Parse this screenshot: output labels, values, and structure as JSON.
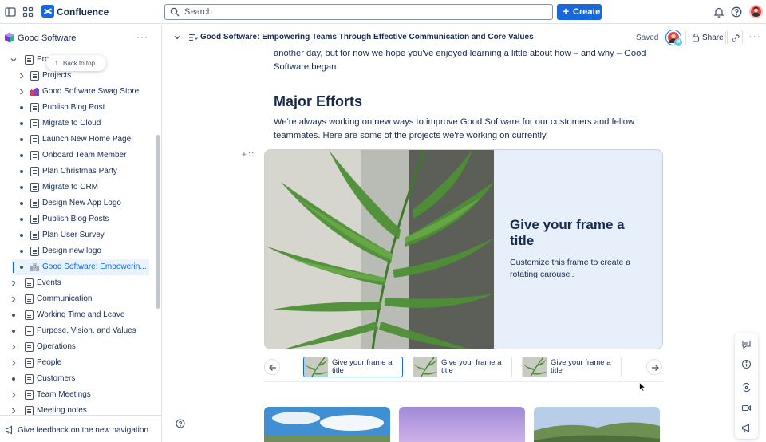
{
  "app": {
    "name": "Confluence",
    "brand_color": "#1868db"
  },
  "topbar": {
    "search_placeholder": "Search",
    "create_label": "Create",
    "icons": [
      "sidebar-toggle-icon",
      "app-switcher-icon",
      "bell-icon",
      "help-icon"
    ]
  },
  "sidebar": {
    "space_name": "Good Software",
    "more_label": "···",
    "back_to_top": "Back to top",
    "items": [
      {
        "label": "Pro",
        "kind": "page",
        "level": 1,
        "expanded": true,
        "chevron": true
      },
      {
        "label": "Projects",
        "kind": "database",
        "level": 2,
        "chevron": true
      },
      {
        "label": "Good Software Swag Store",
        "kind": "emoji",
        "level": 2,
        "chevron": true
      },
      {
        "label": "Publish Blog Post",
        "kind": "page",
        "level": 2
      },
      {
        "label": "Migrate to Cloud",
        "kind": "page",
        "level": 2
      },
      {
        "label": "Launch New Home Page",
        "kind": "page",
        "level": 2
      },
      {
        "label": "Onboard Team Member",
        "kind": "page",
        "level": 2
      },
      {
        "label": "Plan Christmas Party",
        "kind": "page",
        "level": 2
      },
      {
        "label": "Migrate to CRM",
        "kind": "page",
        "level": 2
      },
      {
        "label": "Design New App Logo",
        "kind": "page",
        "level": 2
      },
      {
        "label": "Publish Blog Posts",
        "kind": "page",
        "level": 2
      },
      {
        "label": "Plan User Survey",
        "kind": "page",
        "level": 2
      },
      {
        "label": "Design new logo",
        "kind": "page",
        "level": 2
      },
      {
        "label": "Good Software: Empowerin...",
        "kind": "emoji",
        "level": 2,
        "active": true
      },
      {
        "label": "Events",
        "kind": "page",
        "level": 1,
        "chevron": true
      },
      {
        "label": "Communication",
        "kind": "page",
        "level": 1,
        "chevron": true
      },
      {
        "label": "Working Time and Leave",
        "kind": "page",
        "level": 1
      },
      {
        "label": "Purpose, Vision, and Values",
        "kind": "page",
        "level": 1
      },
      {
        "label": "Operations",
        "kind": "page",
        "level": 1,
        "chevron": true
      },
      {
        "label": "People",
        "kind": "page",
        "level": 1,
        "chevron": true
      },
      {
        "label": "Customers",
        "kind": "page",
        "level": 1
      },
      {
        "label": "Team Meetings",
        "kind": "page",
        "level": 1,
        "chevron": true
      },
      {
        "label": "Meeting notes",
        "kind": "page",
        "level": 1,
        "chevron": true
      }
    ],
    "feedback_label": "Give feedback on the new navigation"
  },
  "page": {
    "title": "Good Software: Empowering Teams Through Effective Communication and Core Values",
    "status": "Saved",
    "avatar_badge": "M",
    "share_label": "Share",
    "more_label": "···",
    "intro_line1": "another day, but for now we hope you've enjoyed learning a little about how – and why – Good",
    "intro_line2": "Software began.",
    "heading": "Major Efforts",
    "body_line1": "We're always working on new ways to improve Good Software for our customers and fellow",
    "body_line2": "teammates. Here are some of the projects we're working on currently.",
    "block_tools": "+ ∷",
    "carousel": {
      "frame_title": "Give your frame a title",
      "frame_description": "Customize this frame to create a rotating carousel.",
      "thumbnails": [
        {
          "label": "Give your frame a title",
          "active": true
        },
        {
          "label": "Give your frame a title",
          "active": false
        },
        {
          "label": "Give your frame a title",
          "active": false
        }
      ],
      "panel_color": "#e7effa"
    }
  },
  "right_toolbar": {
    "icons": [
      "comment-icon",
      "info-icon",
      "loop-icon",
      "video-icon",
      "megaphone-icon"
    ]
  }
}
